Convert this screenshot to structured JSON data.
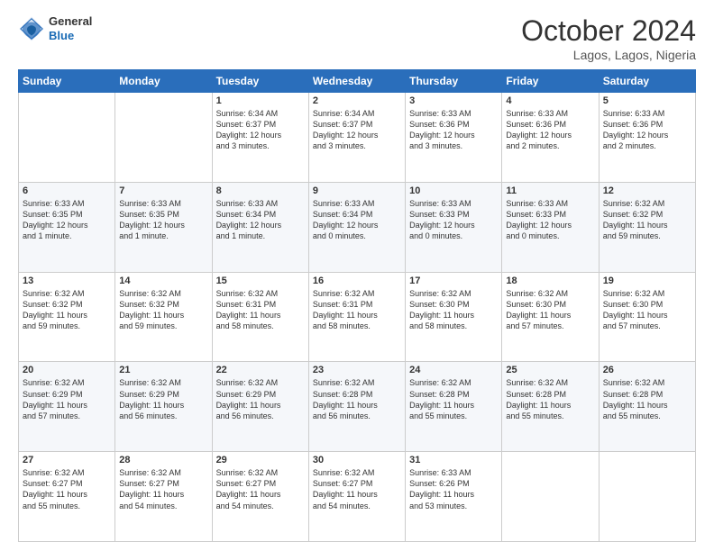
{
  "header": {
    "logo_general": "General",
    "logo_blue": "Blue",
    "month_title": "October 2024",
    "location": "Lagos, Lagos, Nigeria"
  },
  "days_of_week": [
    "Sunday",
    "Monday",
    "Tuesday",
    "Wednesday",
    "Thursday",
    "Friday",
    "Saturday"
  ],
  "weeks": [
    [
      {
        "day": "",
        "info": ""
      },
      {
        "day": "",
        "info": ""
      },
      {
        "day": "1",
        "info": "Sunrise: 6:34 AM\nSunset: 6:37 PM\nDaylight: 12 hours\nand 3 minutes."
      },
      {
        "day": "2",
        "info": "Sunrise: 6:34 AM\nSunset: 6:37 PM\nDaylight: 12 hours\nand 3 minutes."
      },
      {
        "day": "3",
        "info": "Sunrise: 6:33 AM\nSunset: 6:36 PM\nDaylight: 12 hours\nand 3 minutes."
      },
      {
        "day": "4",
        "info": "Sunrise: 6:33 AM\nSunset: 6:36 PM\nDaylight: 12 hours\nand 2 minutes."
      },
      {
        "day": "5",
        "info": "Sunrise: 6:33 AM\nSunset: 6:36 PM\nDaylight: 12 hours\nand 2 minutes."
      }
    ],
    [
      {
        "day": "6",
        "info": "Sunrise: 6:33 AM\nSunset: 6:35 PM\nDaylight: 12 hours\nand 1 minute."
      },
      {
        "day": "7",
        "info": "Sunrise: 6:33 AM\nSunset: 6:35 PM\nDaylight: 12 hours\nand 1 minute."
      },
      {
        "day": "8",
        "info": "Sunrise: 6:33 AM\nSunset: 6:34 PM\nDaylight: 12 hours\nand 1 minute."
      },
      {
        "day": "9",
        "info": "Sunrise: 6:33 AM\nSunset: 6:34 PM\nDaylight: 12 hours\nand 0 minutes."
      },
      {
        "day": "10",
        "info": "Sunrise: 6:33 AM\nSunset: 6:33 PM\nDaylight: 12 hours\nand 0 minutes."
      },
      {
        "day": "11",
        "info": "Sunrise: 6:33 AM\nSunset: 6:33 PM\nDaylight: 12 hours\nand 0 minutes."
      },
      {
        "day": "12",
        "info": "Sunrise: 6:32 AM\nSunset: 6:32 PM\nDaylight: 11 hours\nand 59 minutes."
      }
    ],
    [
      {
        "day": "13",
        "info": "Sunrise: 6:32 AM\nSunset: 6:32 PM\nDaylight: 11 hours\nand 59 minutes."
      },
      {
        "day": "14",
        "info": "Sunrise: 6:32 AM\nSunset: 6:32 PM\nDaylight: 11 hours\nand 59 minutes."
      },
      {
        "day": "15",
        "info": "Sunrise: 6:32 AM\nSunset: 6:31 PM\nDaylight: 11 hours\nand 58 minutes."
      },
      {
        "day": "16",
        "info": "Sunrise: 6:32 AM\nSunset: 6:31 PM\nDaylight: 11 hours\nand 58 minutes."
      },
      {
        "day": "17",
        "info": "Sunrise: 6:32 AM\nSunset: 6:30 PM\nDaylight: 11 hours\nand 58 minutes."
      },
      {
        "day": "18",
        "info": "Sunrise: 6:32 AM\nSunset: 6:30 PM\nDaylight: 11 hours\nand 57 minutes."
      },
      {
        "day": "19",
        "info": "Sunrise: 6:32 AM\nSunset: 6:30 PM\nDaylight: 11 hours\nand 57 minutes."
      }
    ],
    [
      {
        "day": "20",
        "info": "Sunrise: 6:32 AM\nSunset: 6:29 PM\nDaylight: 11 hours\nand 57 minutes."
      },
      {
        "day": "21",
        "info": "Sunrise: 6:32 AM\nSunset: 6:29 PM\nDaylight: 11 hours\nand 56 minutes."
      },
      {
        "day": "22",
        "info": "Sunrise: 6:32 AM\nSunset: 6:29 PM\nDaylight: 11 hours\nand 56 minutes."
      },
      {
        "day": "23",
        "info": "Sunrise: 6:32 AM\nSunset: 6:28 PM\nDaylight: 11 hours\nand 56 minutes."
      },
      {
        "day": "24",
        "info": "Sunrise: 6:32 AM\nSunset: 6:28 PM\nDaylight: 11 hours\nand 55 minutes."
      },
      {
        "day": "25",
        "info": "Sunrise: 6:32 AM\nSunset: 6:28 PM\nDaylight: 11 hours\nand 55 minutes."
      },
      {
        "day": "26",
        "info": "Sunrise: 6:32 AM\nSunset: 6:28 PM\nDaylight: 11 hours\nand 55 minutes."
      }
    ],
    [
      {
        "day": "27",
        "info": "Sunrise: 6:32 AM\nSunset: 6:27 PM\nDaylight: 11 hours\nand 55 minutes."
      },
      {
        "day": "28",
        "info": "Sunrise: 6:32 AM\nSunset: 6:27 PM\nDaylight: 11 hours\nand 54 minutes."
      },
      {
        "day": "29",
        "info": "Sunrise: 6:32 AM\nSunset: 6:27 PM\nDaylight: 11 hours\nand 54 minutes."
      },
      {
        "day": "30",
        "info": "Sunrise: 6:32 AM\nSunset: 6:27 PM\nDaylight: 11 hours\nand 54 minutes."
      },
      {
        "day": "31",
        "info": "Sunrise: 6:33 AM\nSunset: 6:26 PM\nDaylight: 11 hours\nand 53 minutes."
      },
      {
        "day": "",
        "info": ""
      },
      {
        "day": "",
        "info": ""
      }
    ]
  ]
}
